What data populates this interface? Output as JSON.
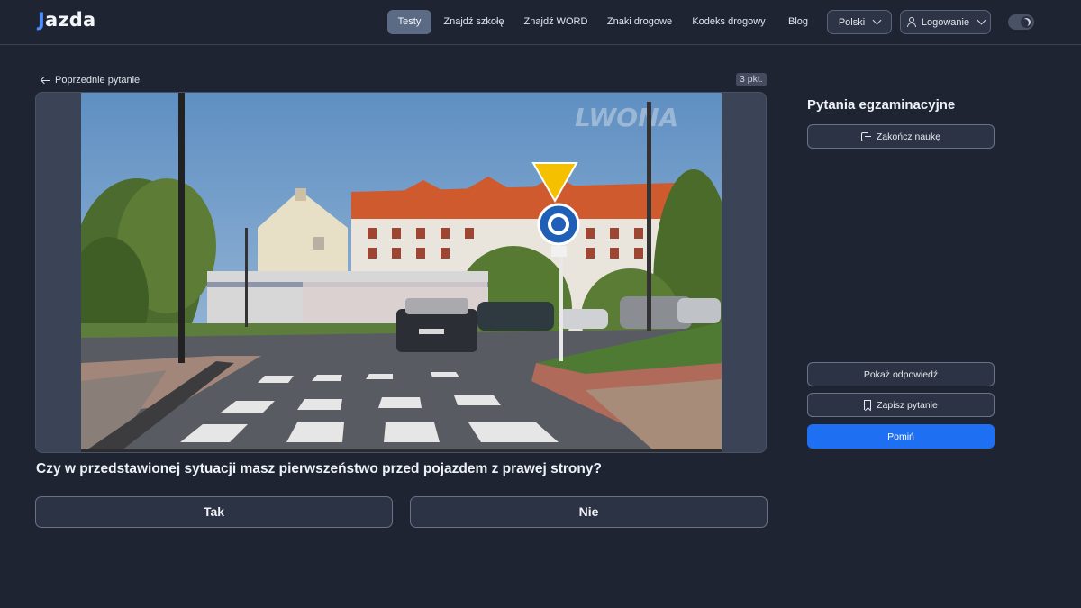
{
  "header": {
    "logo": "Jazda",
    "nav": [
      {
        "label": "Testy",
        "active": true
      },
      {
        "label": "Znajdź szkołę",
        "active": false
      },
      {
        "label": "Znajdź WORD",
        "active": false
      },
      {
        "label": "Znaki drogowe",
        "active": false
      },
      {
        "label": "Kodeks drogowy",
        "active": false
      },
      {
        "label": "Blog",
        "active": false
      }
    ],
    "language": "Polski",
    "login": "Logowanie",
    "theme": "dark"
  },
  "question": {
    "back_label": "Poprzednie pytanie",
    "points": "3 pkt.",
    "text": "Czy w przedstawionej sytuacji masz pierwszeństwo przed pojazdem z prawej strony?",
    "watermark": "LWONA",
    "answers": [
      "Tak",
      "Nie"
    ]
  },
  "sidebar": {
    "title": "Pytania egzaminacyjne",
    "end_label": "Zakończ naukę",
    "show_answer_label": "Pokaż odpowiedź",
    "save_label": "Zapisz pytanie",
    "skip_label": "Pomiń"
  },
  "colors": {
    "background": "#1f2433",
    "accent": "#1f6ff2",
    "active_nav": "#5b6b85"
  }
}
